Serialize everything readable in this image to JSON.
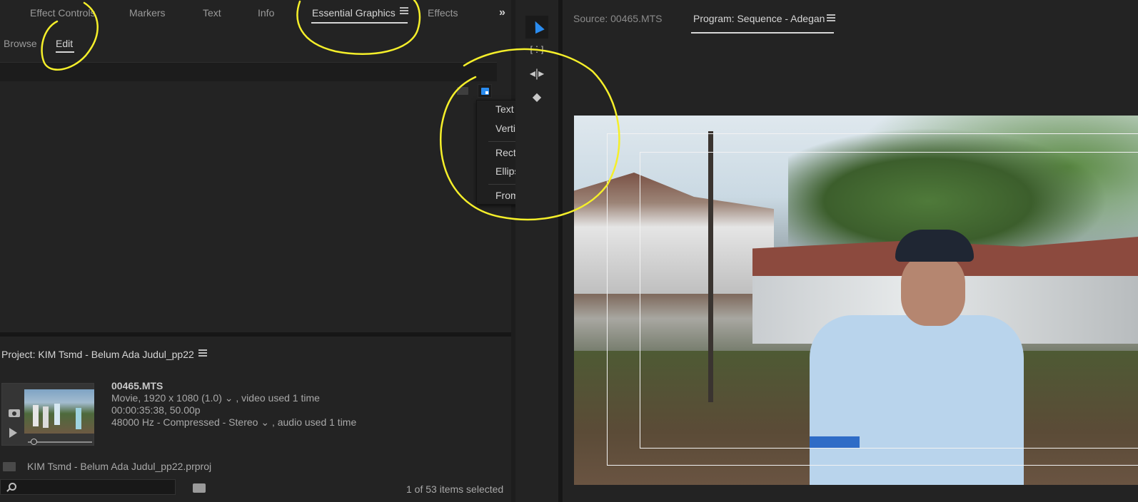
{
  "left_panel": {
    "tabs": [
      {
        "label": "Effect Controls"
      },
      {
        "label": "Markers"
      },
      {
        "label": "Text"
      },
      {
        "label": "Info"
      },
      {
        "label": "Essential Graphics"
      },
      {
        "label": "Effects"
      }
    ],
    "active_tab": "Essential Graphics",
    "overflow_glyph": "»",
    "subtabs": [
      {
        "label": "Browse"
      },
      {
        "label": "Edit"
      }
    ],
    "active_subtab": "Edit",
    "new_layer_menu": {
      "items": [
        "Text",
        "Vertical Text",
        "Rectangle",
        "Ellipse",
        "From File..."
      ]
    }
  },
  "project": {
    "title": "Project: KIM Tsmd - Belum Ada Judul_pp22",
    "clip": {
      "name": "00465.MTS",
      "line1_a": "Movie, 1920 x 1080 (1.0)",
      "line1_b": ", video used 1 time",
      "line2": "00:00:35:38, 50.00p",
      "line3_a": "48000 Hz - Compressed - Stereo",
      "line3_b": ", audio used 1 time"
    },
    "file": "KIM Tsmd - Belum Ada Judul_pp22.prproj",
    "status": "1 of 53 items selected",
    "search_value": ""
  },
  "tools": [
    {
      "name": "selection-tool",
      "icon": "arrow-icon"
    },
    {
      "name": "track-select-tool",
      "icon": "track-select-icon"
    },
    {
      "name": "ripple-edit-tool",
      "icon": "ripple-edit-icon"
    },
    {
      "name": "razor-tool",
      "icon": "razor-icon"
    }
  ],
  "monitor": {
    "source_tab": "Source: 00465.MTS",
    "program_tab": "Program: Sequence - Adegan"
  },
  "colors": {
    "accent": "#2a8cf0",
    "annotation": "#f5ef2a",
    "panel_bg": "#232323"
  }
}
